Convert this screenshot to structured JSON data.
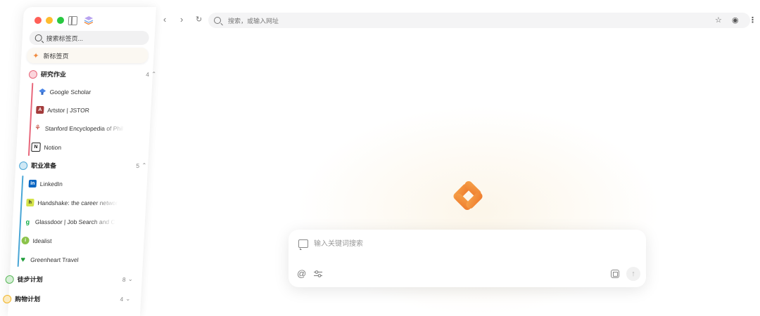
{
  "sidebar": {
    "search_placeholder": "搜索标签页...",
    "new_tab": "新标签页",
    "groups": [
      {
        "name": "研究作业",
        "count": "4",
        "color": "#e8677b",
        "expanded": true,
        "items": [
          {
            "label": "Google Scholar",
            "icon": "scholar-icon"
          },
          {
            "label": "Artstor | JSTOR",
            "icon": "artstor-icon"
          },
          {
            "label": "Stanford Encyclopedia of Phil",
            "icon": "stanford-icon"
          },
          {
            "label": "Notion",
            "icon": "notion-icon"
          }
        ]
      },
      {
        "name": "职业准备",
        "count": "5",
        "color": "#49a6d6",
        "expanded": true,
        "items": [
          {
            "label": "LinkedIn",
            "icon": "linkedin-icon"
          },
          {
            "label": "Handshake: the career networ",
            "icon": "handshake-icon"
          },
          {
            "label": "Glassdoor | Job Search and C",
            "icon": "glassdoor-icon"
          },
          {
            "label": "Idealist",
            "icon": "idealist-icon"
          },
          {
            "label": "Greenheart Travel",
            "icon": "greenheart-icon"
          }
        ]
      },
      {
        "name": "徒步计划",
        "count": "8",
        "color": "#5cb85c",
        "expanded": false
      },
      {
        "name": "购物计划",
        "count": "4",
        "color": "#f0b429",
        "expanded": false
      }
    ]
  },
  "toolbar": {
    "url_placeholder": "搜索，或输入网址"
  },
  "prompt": {
    "placeholder": "输入关键词搜索"
  },
  "colors": {
    "accent": "#f08a3e"
  }
}
